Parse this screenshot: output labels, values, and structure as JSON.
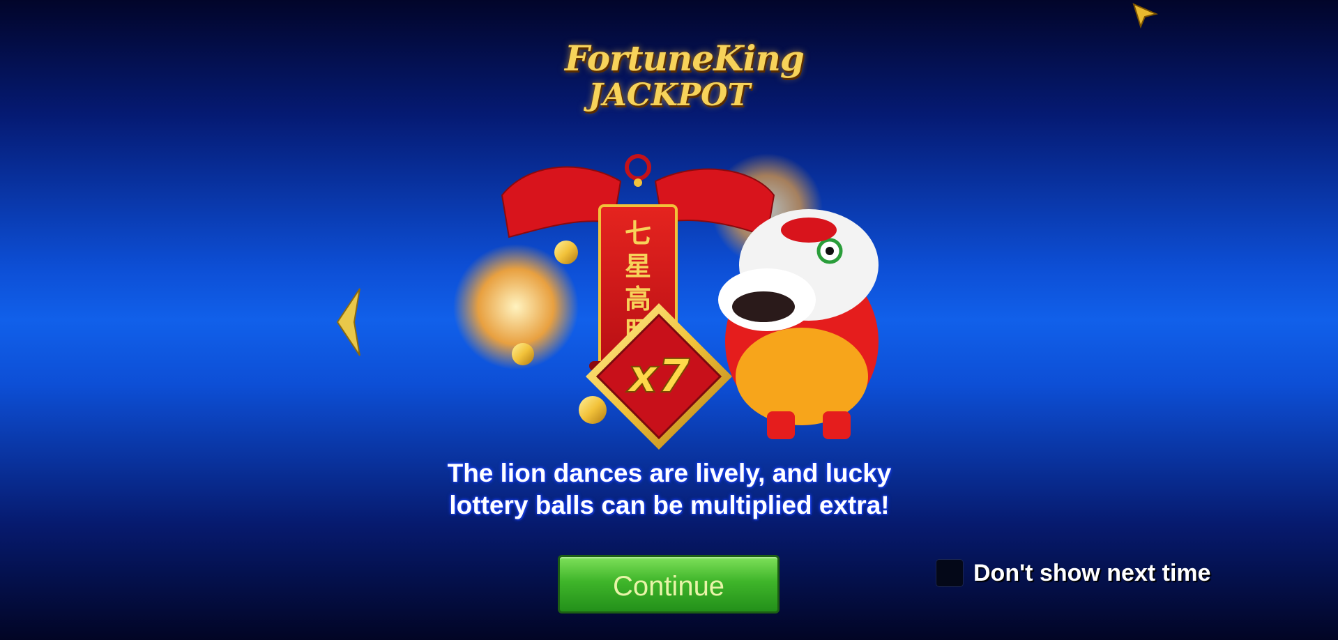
{
  "logo": {
    "line1": "FortuneKing",
    "line2": "JACKPOT"
  },
  "banner": {
    "characters": [
      "七",
      "星",
      "高",
      "照"
    ]
  },
  "multiplier": "x7",
  "caption": {
    "line1": "The lion dances are lively, and lucky",
    "line2": "lottery balls can be multiplied extra!"
  },
  "buttons": {
    "continue": "Continue"
  },
  "dont_show": {
    "label": "Don't show next time",
    "checked": false
  },
  "icons": {
    "prev": "chevron-left-icon",
    "pointer": "cursor-arrow-icon"
  },
  "colors": {
    "gold": "#f7d35a",
    "red": "#d8141c",
    "button_green": "#3fb52a"
  }
}
